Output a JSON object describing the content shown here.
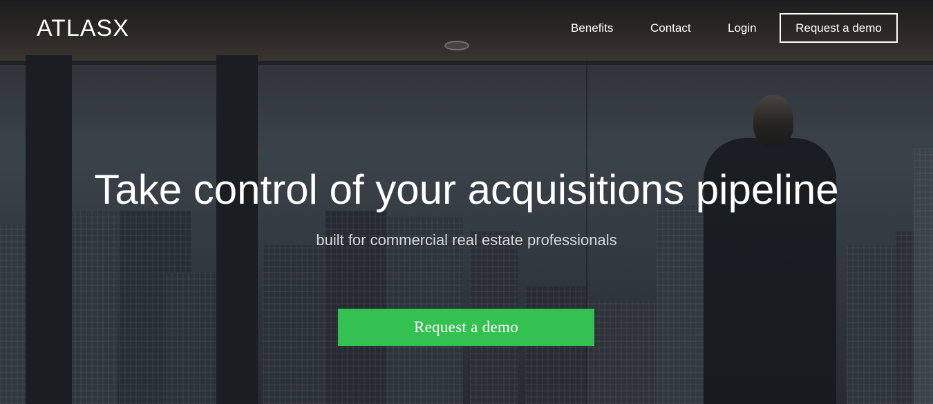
{
  "header": {
    "logo_text": "ATLASX",
    "nav": [
      {
        "label": "Benefits"
      },
      {
        "label": "Contact"
      },
      {
        "label": "Login"
      }
    ],
    "demo_button_label": "Request a demo"
  },
  "hero": {
    "headline": "Take control of your acquisitions pipeline",
    "subheadline": "built for commercial real estate professionals",
    "cta_label": "Request a demo",
    "cta_color": "#34c152"
  }
}
